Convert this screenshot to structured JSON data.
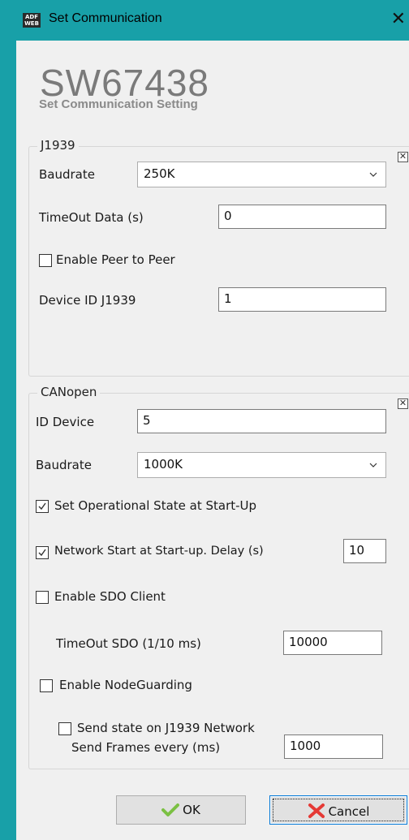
{
  "window": {
    "title": "Set Communication",
    "icon_text_top": "ADF",
    "icon_text_bottom": "WEB"
  },
  "header": {
    "model": "SW67438",
    "subtitle": "Set Communication Setting"
  },
  "j1939": {
    "legend": "J1939",
    "baudrate_label": "Baudrate",
    "baudrate_value": "250K",
    "timeout_label": "TimeOut Data (s)",
    "timeout_value": "0",
    "peer_label": "Enable Peer to Peer",
    "peer_checked": false,
    "device_id_label": "Device ID J1939",
    "device_id_value": "1"
  },
  "canopen": {
    "legend": "CANopen",
    "id_label": "ID Device",
    "id_value": "5",
    "baudrate_label": "Baudrate",
    "baudrate_value": "1000K",
    "opstate_label": "Set Operational State at Start-Up",
    "opstate_checked": true,
    "netstart_label": "Network Start at Start-up. Delay (s)",
    "netstart_checked": true,
    "netstart_value": "10",
    "sdo_label": "Enable SDO Client",
    "sdo_checked": false,
    "sdo_timeout_label": "TimeOut SDO (1/10 ms)",
    "sdo_timeout_value": "10000",
    "nodeguard_label": "Enable NodeGuarding",
    "nodeguard_checked": false,
    "sendstate_label": "Send state on J1939 Network",
    "sendstate_checked": false,
    "frames_label": "Send Frames every (ms)",
    "frames_value": "1000"
  },
  "buttons": {
    "ok": "OK",
    "cancel": "Cancel"
  },
  "colors": {
    "titlebar": "#18a0a8",
    "check": "#333333"
  }
}
